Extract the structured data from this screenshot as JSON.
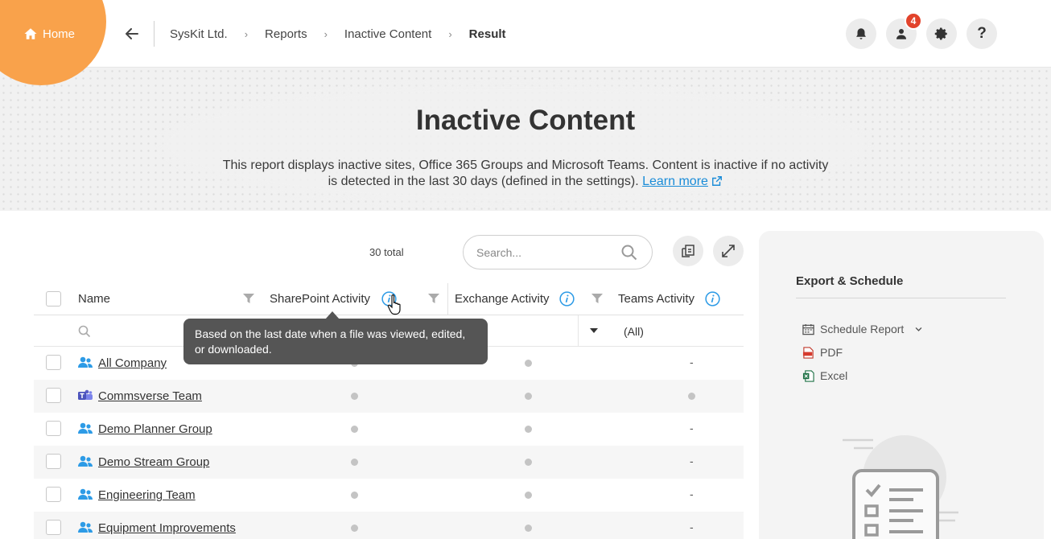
{
  "header": {
    "home_label": "Home",
    "breadcrumbs": [
      "SysKit Ltd.",
      "Reports",
      "Inactive Content"
    ],
    "current": "Result",
    "notification_count": "4"
  },
  "hero": {
    "title": "Inactive Content",
    "desc_line1": "This report displays inactive sites, Office 365 Groups and Microsoft Teams. Content is inactive if no activity",
    "desc_line2": "is detected in the last 30 days (defined in the settings).",
    "learn_more": "Learn more"
  },
  "toolbar": {
    "total": "30 total",
    "search_placeholder": "Search..."
  },
  "table": {
    "columns": {
      "name": "Name",
      "sharepoint": "SharePoint Activity",
      "exchange": "Exchange Activity",
      "teams": "Teams Activity"
    },
    "teams_filter": "(All)",
    "rows": [
      {
        "name": "All Company",
        "icon": "group-icon",
        "teams": "-"
      },
      {
        "name": "Commsverse Team",
        "icon": "teams-icon",
        "teams": "dot"
      },
      {
        "name": "Demo Planner Group",
        "icon": "group-icon",
        "teams": "-"
      },
      {
        "name": "Demo Stream Group",
        "icon": "group-icon",
        "teams": "-"
      },
      {
        "name": "Engineering Team",
        "icon": "group-icon",
        "teams": "-"
      },
      {
        "name": "Equipment Improvements",
        "icon": "group-icon",
        "teams": "-"
      }
    ]
  },
  "tooltip": {
    "text": "Based on the last date when a file was viewed, edited, or downloaded."
  },
  "export_panel": {
    "title": "Export & Schedule",
    "schedule": "Schedule Report",
    "pdf": "PDF",
    "excel": "Excel"
  },
  "colors": {
    "accent": "#f9a24b",
    "link": "#1a8cd8",
    "info": "#2d9be6",
    "badge": "#e2432b"
  }
}
